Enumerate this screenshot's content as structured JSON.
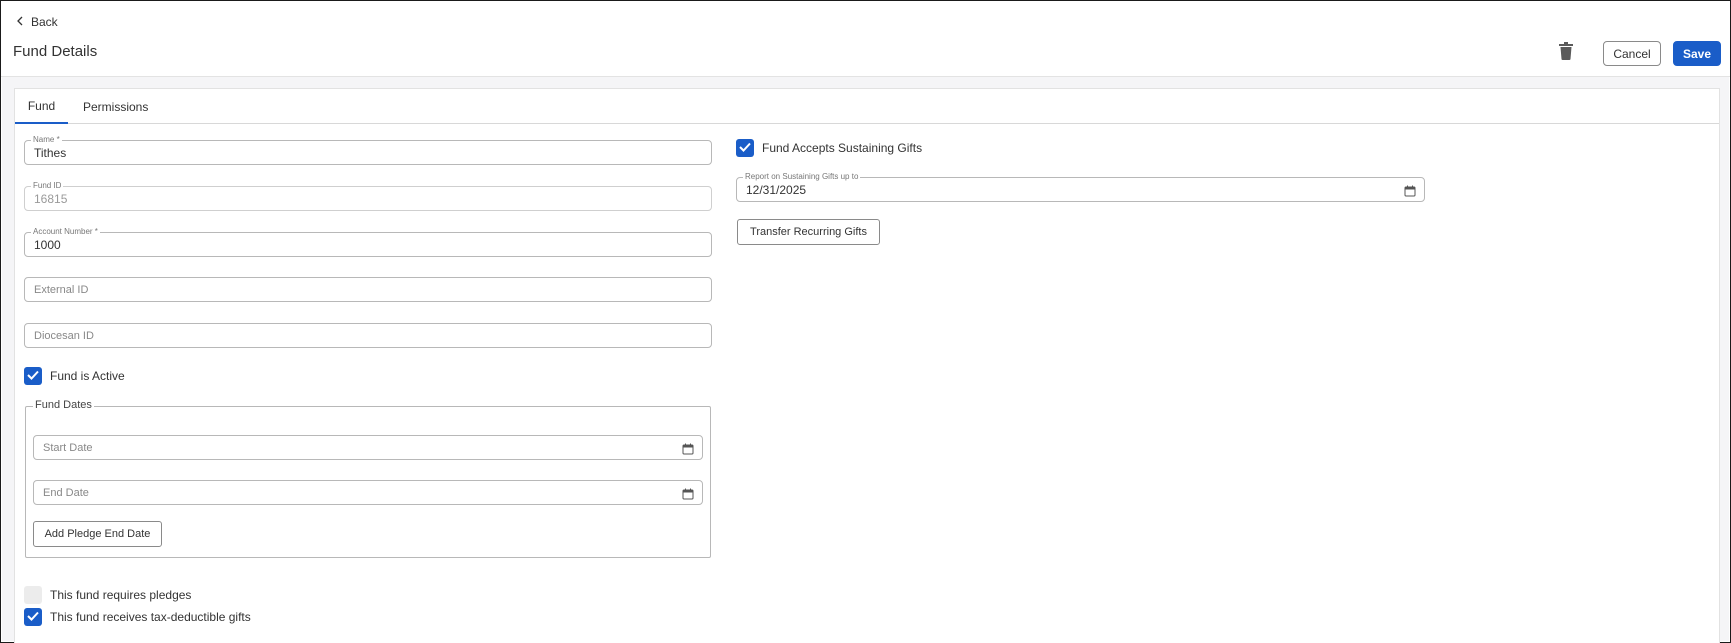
{
  "header": {
    "back_label": "Back",
    "title": "Fund Details",
    "cancel_label": "Cancel",
    "save_label": "Save"
  },
  "tabs": [
    {
      "label": "Fund",
      "active": true
    },
    {
      "label": "Permissions",
      "active": false
    }
  ],
  "form": {
    "name": {
      "label": "Name *",
      "value": "Tithes"
    },
    "fund_id": {
      "label": "Fund ID",
      "value": "16815"
    },
    "account_number": {
      "label": "Account Number *",
      "value": "1000"
    },
    "external_id": {
      "placeholder": "External ID"
    },
    "diocesan_id": {
      "placeholder": "Diocesan ID"
    },
    "fund_is_active": {
      "label": "Fund is Active",
      "checked": true
    },
    "fund_dates": {
      "legend": "Fund Dates",
      "start_date_placeholder": "Start Date",
      "end_date_placeholder": "End Date",
      "add_pledge_label": "Add Pledge End Date"
    },
    "requires_pledges": {
      "label": "This fund requires pledges",
      "checked": false
    },
    "tax_deductible": {
      "label": "This fund receives tax-deductible gifts",
      "checked": true
    },
    "accepts_sustaining": {
      "label": "Fund Accepts Sustaining Gifts",
      "checked": true
    },
    "report_sustaining": {
      "label": "Report on Sustaining Gifts up to",
      "value": "12/31/2025"
    },
    "transfer_label": "Transfer Recurring Gifts"
  },
  "colors": {
    "accent": "#1a5dc8",
    "border": "#b8b8b8"
  },
  "icons": [
    "chevron-left-icon",
    "trash-icon",
    "calendar-icon",
    "checkmark-icon"
  ]
}
